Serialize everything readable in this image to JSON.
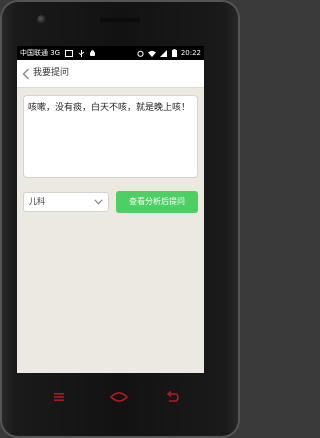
{
  "statusbar": {
    "carrier": "中国联通 3G",
    "time": "20:22"
  },
  "header": {
    "title": "我要提问"
  },
  "question": {
    "text": "咳嗽，没有痰，白天不咳，就是晚上咳！"
  },
  "department": {
    "selected": "儿科"
  },
  "actions": {
    "analyze_label": "查看分析后提问"
  },
  "colors": {
    "accent": "#4ccf63",
    "nav_button": "#b0191f",
    "background": "#ece8e2"
  },
  "icons": {
    "back": "back-arrow-icon",
    "dropdown": "chevron-down-icon",
    "menu": "menu-icon",
    "home": "home-icon",
    "back_nav": "back-nav-icon"
  }
}
